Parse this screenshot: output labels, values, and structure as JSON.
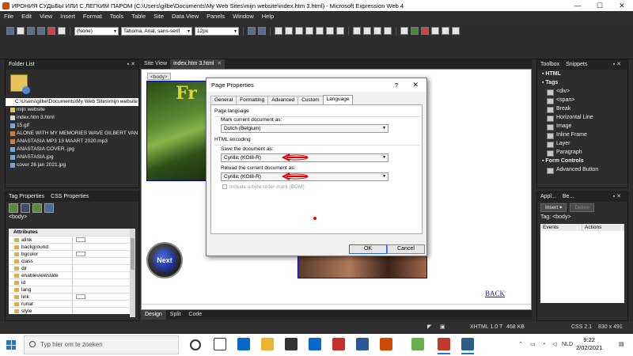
{
  "window": {
    "title": "ИРОНИЯ СУДЬБЫ ИЛИ С ЛЕГКИМ ПАРОМ (C:\\Users\\gilbe\\Documents\\My Web Sites\\mijn website\\index.htm 3.html) - Microsoft Expression Web 4",
    "minimize": "—",
    "maximize": "☐",
    "close": "✕"
  },
  "menu": [
    "File",
    "Edit",
    "View",
    "Insert",
    "Format",
    "Tools",
    "Table",
    "Site",
    "Data View",
    "Panels",
    "Window",
    "Help"
  ],
  "toolbar": {
    "style_select": "(None)",
    "font_select": "Tahoma, Arial, sans-serif",
    "size_select": "12px"
  },
  "folder_list": {
    "header": "Folder List",
    "path": "C:\\Users\\gilbe\\Documents\\My Web Sites\\mijn website",
    "items": [
      {
        "name": "mijn website",
        "kind": "folder"
      },
      {
        "name": "index.htm 3.html",
        "kind": "file"
      },
      {
        "name": "15.gif",
        "kind": "img"
      },
      {
        "name": "ALONE WITH MY MEMORIES WAVE GILBERT VAN",
        "kind": "audio"
      },
      {
        "name": "ANASTASIA  MP3 13 MAART 2020.mp3",
        "kind": "audio"
      },
      {
        "name": "ANASTASIA COVER..jpg",
        "kind": "img"
      },
      {
        "name": "ANASTASIA.jpg",
        "kind": "img"
      },
      {
        "name": "cover 26 jan 2021.jpg",
        "kind": "img"
      }
    ]
  },
  "tag_properties": {
    "tabs": [
      "Tag Properties",
      "CSS Properties"
    ],
    "tag": "<body>",
    "attributes_header": "Attributes",
    "attributes": [
      {
        "name": "alink",
        "box": true
      },
      {
        "name": "background",
        "box": false
      },
      {
        "name": "bgcolor",
        "box": true
      },
      {
        "name": "class",
        "box": false
      },
      {
        "name": "dir",
        "box": false
      },
      {
        "name": "enableviewstate",
        "box": false
      },
      {
        "name": "id",
        "box": false
      },
      {
        "name": "lang",
        "box": false
      },
      {
        "name": "link",
        "box": true
      },
      {
        "name": "runat",
        "box": false
      },
      {
        "name": "style",
        "box": false
      }
    ]
  },
  "editor": {
    "tabs": [
      {
        "label": "Site View",
        "active": false
      },
      {
        "label": "index.htm 3.html",
        "active": true
      }
    ],
    "body_tag": "<body>",
    "next_button": "Next",
    "back_link": "BACK",
    "view_tabs": [
      "Design",
      "Split",
      "Code"
    ]
  },
  "toolbox": {
    "tabs": [
      "Toolbox",
      "Snippets"
    ],
    "items": [
      {
        "label": "HTML",
        "type": "cat"
      },
      {
        "label": "Tags",
        "type": "cat"
      },
      {
        "label": "<div>",
        "type": "sub"
      },
      {
        "label": "<span>",
        "type": "sub"
      },
      {
        "label": "Break",
        "type": "sub"
      },
      {
        "label": "Horizontal Line",
        "type": "sub"
      },
      {
        "label": "Image",
        "type": "sub"
      },
      {
        "label": "Inline Frame",
        "type": "sub"
      },
      {
        "label": "Layer",
        "type": "sub"
      },
      {
        "label": "Paragraph",
        "type": "sub"
      },
      {
        "label": "Form Controls",
        "type": "cat"
      },
      {
        "label": "Advanced Button",
        "type": "sub"
      }
    ]
  },
  "apply_styles": {
    "tabs": [
      "Appl...",
      "Be..."
    ],
    "insert_label": "Insert ▾",
    "delete_label": "Delete",
    "tag_line": "Tag:   <body>",
    "columns": [
      "Events",
      "Actions"
    ]
  },
  "status": {
    "doctype": "XHTML 1.0 T",
    "size": "468 KB",
    "css": "CSS 2.1",
    "dimensions": "830 x 491"
  },
  "dialog": {
    "title": "Page Properties",
    "help": "?",
    "close": "✕",
    "tabs": [
      {
        "label": "General",
        "active": false
      },
      {
        "label": "Formatting",
        "active": false
      },
      {
        "label": "Advanced",
        "active": false
      },
      {
        "label": "Custom",
        "active": false
      },
      {
        "label": "Language",
        "active": true
      }
    ],
    "page_language_group": "Page language",
    "mark_label": "Mark current document as:",
    "mark_value": "Dutch (Belgium)",
    "html_encoding_group": "HTML encoding",
    "save_label": "Save the document as:",
    "save_value": "Cyrillic (KOI8-R)",
    "reload_label": "Reload the current document as:",
    "reload_value": "Cyrillic (KOI8-R)",
    "bom_label": "Include a byte order mark (BOM)",
    "ok": "OK",
    "cancel": "Cancel"
  },
  "taskbar": {
    "search_placeholder": "Typ hier om te zoeken",
    "language": "NLD",
    "time": "9:22",
    "date": "2/02/2021"
  }
}
